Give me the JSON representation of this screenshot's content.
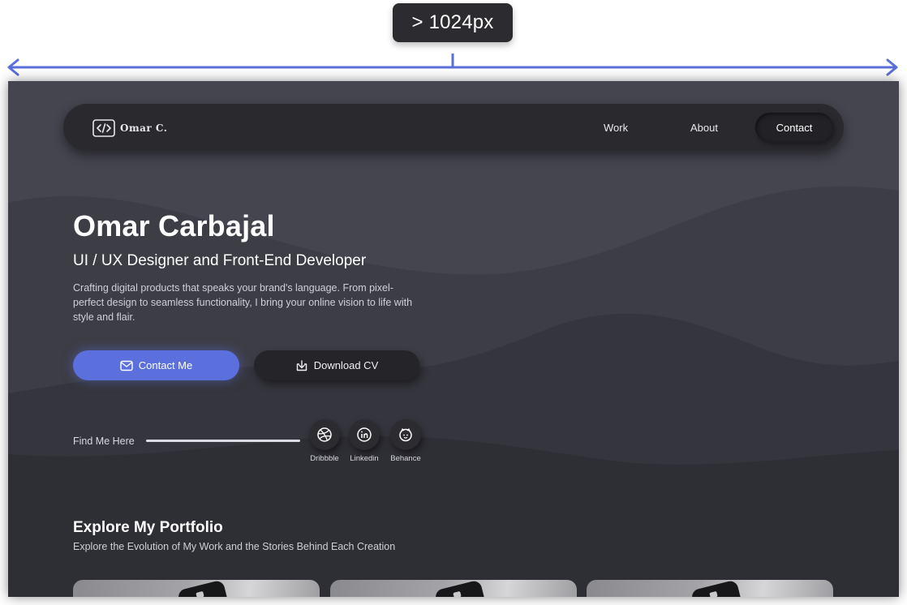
{
  "annotation": {
    "width_badge": "> 1024px",
    "accent_color": "#5a6fd8"
  },
  "navbar": {
    "logo_text": "Omar C.",
    "logo_icon": "code-icon",
    "links": [
      "Work",
      "About"
    ],
    "cta_label": "Contact"
  },
  "hero": {
    "name": "Omar Carbajal",
    "role": "UI / UX Designer and Front-End Developer",
    "description": "Crafting digital products that speaks your brand's language. From pixel-perfect design to seamless functionality, I bring your online vision to life with style and flair.",
    "primary_button": {
      "label": "Contact Me",
      "icon": "mail-icon",
      "color": "#5b6fdd"
    },
    "secondary_button": {
      "label": "Download CV",
      "icon": "download-icon"
    }
  },
  "find_me": {
    "label": "Find Me Here",
    "socials": [
      {
        "label": "Dribbble",
        "icon": "dribbble-icon"
      },
      {
        "label": "Linkedin",
        "icon": "linkedin-icon"
      },
      {
        "label": "Behance",
        "icon": "behance-icon"
      }
    ]
  },
  "portfolio": {
    "title": "Explore My Portfolio",
    "subtitle": "Explore the Evolution of My Work and the Stories Behind Each Creation",
    "cards": 3
  },
  "colors": {
    "background": "#45454f",
    "background_dark": "#2e2e35",
    "surface": "#29292e",
    "text": "#ffffff"
  }
}
